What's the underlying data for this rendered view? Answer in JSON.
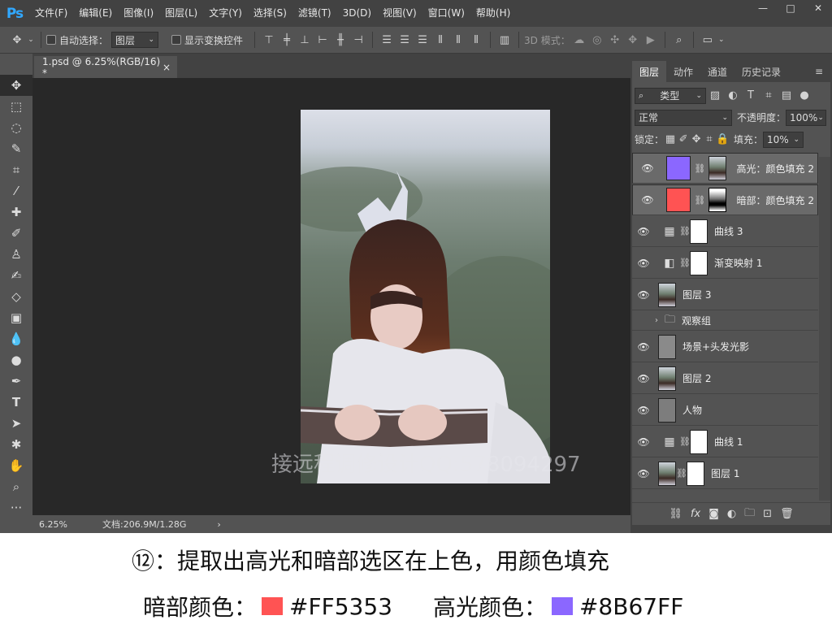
{
  "app": {
    "logo": "Ps"
  },
  "menu": [
    "文件(F)",
    "编辑(E)",
    "图像(I)",
    "图层(L)",
    "文字(Y)",
    "选择(S)",
    "滤镜(T)",
    "3D(D)",
    "视图(V)",
    "窗口(W)",
    "帮助(H)"
  ],
  "options": {
    "auto_select_label": "自动选择：",
    "auto_select_value": "图层",
    "show_transform_label": "显示变换控件",
    "mode_3d_label": "3D 模式："
  },
  "document": {
    "tab_title": "1.psd @ 6.25%(RGB/16) *",
    "tab_close": "×",
    "zoom": "6.25%",
    "doc_info": "文档:206.9M/1.28G",
    "watermark": "接远程调修设计QQ:578094297"
  },
  "panel": {
    "tabs": [
      "图层",
      "动作",
      "通道",
      "历史记录"
    ],
    "filter_kind": "类型",
    "blend_mode": "正常",
    "opacity_label": "不透明度：",
    "opacity_value": "100%",
    "lock_label": "锁定：",
    "fill_label": "填充：",
    "fill_value": "10%",
    "layers": [
      {
        "name": "高光：颜色填充 2",
        "visible": true,
        "kind": "fill",
        "color": "#8B67FF",
        "selected": true
      },
      {
        "name": "暗部：颜色填充 2",
        "visible": true,
        "kind": "fill",
        "color": "#FF5353",
        "selected": true
      },
      {
        "name": "曲线 3",
        "visible": true,
        "kind": "curves"
      },
      {
        "name": "渐变映射 1",
        "visible": true,
        "kind": "gradient"
      },
      {
        "name": "图层 3",
        "visible": true,
        "kind": "photo"
      },
      {
        "name": "观察组",
        "visible": false,
        "kind": "group"
      },
      {
        "name": "场景+头发光影",
        "visible": true,
        "kind": "gray"
      },
      {
        "name": "图层 2",
        "visible": true,
        "kind": "photo"
      },
      {
        "name": "人物",
        "visible": true,
        "kind": "gray"
      },
      {
        "name": "曲线 1",
        "visible": true,
        "kind": "curves"
      },
      {
        "name": "图层 1",
        "visible": true,
        "kind": "photo-mask"
      }
    ]
  },
  "caption": {
    "step_line": "⑫：提取出高光和暗部选区在上色，用颜色填充",
    "dark_label": "暗部颜色：",
    "dark_hex": "#FF5353",
    "highlight_label": "高光颜色：",
    "highlight_hex": "#8B67FF"
  },
  "colors": {
    "dark": "#FF5353",
    "highlight": "#8B67FF",
    "ps_blue": "#31a8ff"
  }
}
